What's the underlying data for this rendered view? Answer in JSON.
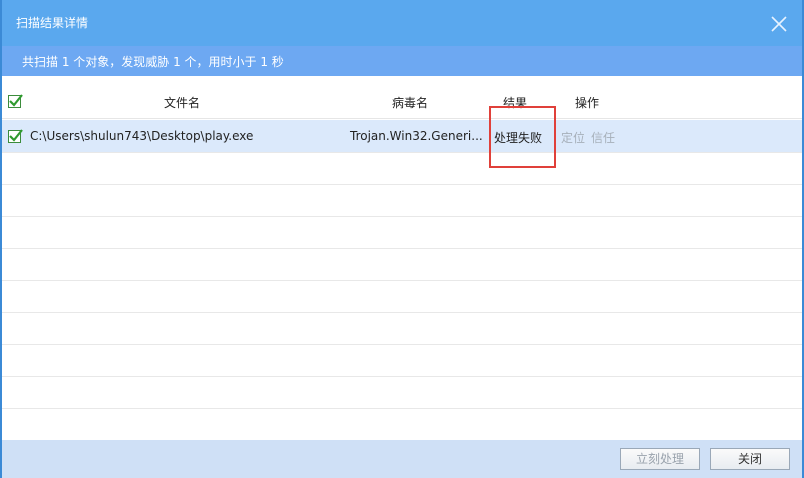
{
  "window": {
    "title": "扫描结果详情"
  },
  "summary": {
    "text": "共扫描 1 个对象，发现威胁 1 个，用时小于 1 秒"
  },
  "table": {
    "headers": {
      "file_name": "文件名",
      "virus_name": "病毒名",
      "result": "结果",
      "action": "操作"
    },
    "rows": [
      {
        "checked": true,
        "file_path": "C:\\Users\\shulun743\\Desktop\\play.exe",
        "virus_name": "Trojan.Win32.Generi...",
        "result": "处理失败",
        "locate_label": "定位",
        "trust_label": "信任"
      }
    ]
  },
  "footer": {
    "process_now_label": "立刻处理",
    "close_label": "关闭"
  },
  "colors": {
    "titlebar": "#5aa8ee",
    "summary_bar": "#6da8f2",
    "selected_row": "#dbe9fb",
    "highlight_box": "#e0403a",
    "footer": "#cfe0f6"
  }
}
